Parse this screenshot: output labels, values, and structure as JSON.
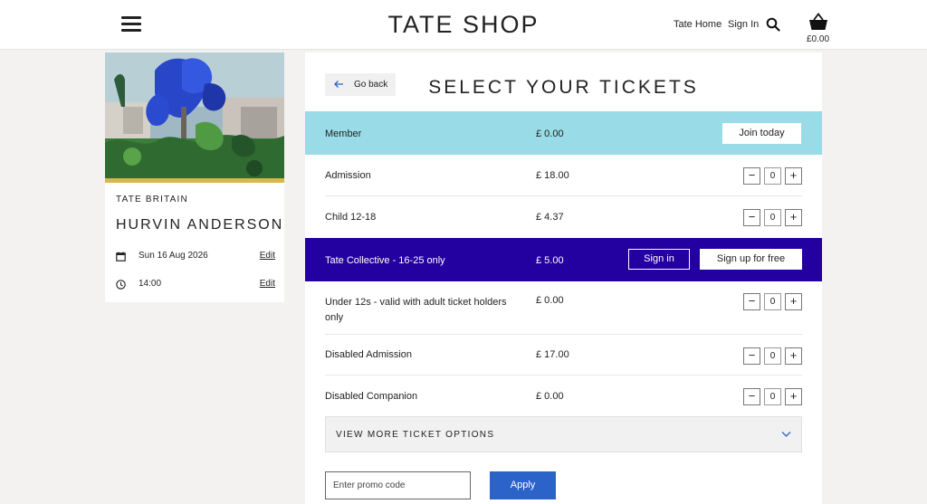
{
  "header": {
    "brand": "TATE SHOP",
    "links": {
      "home": "Tate Home",
      "sign_in": "Sign In"
    },
    "basket_total": "£0.00"
  },
  "event": {
    "venue": "TATE BRITAIN",
    "title": "HURVIN ANDERSON",
    "date": "Sun 16 Aug 2026",
    "time": "14:00",
    "edit_label": "Edit"
  },
  "main": {
    "go_back": "Go back",
    "title": "SELECT YOUR TICKETS",
    "member": {
      "name": "Member",
      "price": "£ 0.00",
      "action": "Join today"
    },
    "tickets": [
      {
        "name": "Admission",
        "price": "£ 18.00",
        "qty": "0"
      },
      {
        "name": "Child 12-18",
        "price": "£ 4.37",
        "qty": "0"
      },
      {
        "name": "Under 12s - valid with adult ticket holders only",
        "price": "£ 0.00",
        "qty": "0"
      },
      {
        "name": "Disabled Admission",
        "price": "£ 17.00",
        "qty": "0"
      },
      {
        "name": "Disabled Companion",
        "price": "£ 0.00",
        "qty": "0"
      }
    ],
    "collective": {
      "name": "Tate Collective - 16-25 only",
      "price": "£ 5.00",
      "sign_in": "Sign in",
      "sign_up": "Sign up for free"
    },
    "more_options": "VIEW MORE TICKET OPTIONS",
    "promo_placeholder": "Enter promo code",
    "apply": "Apply",
    "stepper_minus": "−",
    "stepper_plus": "+"
  },
  "colors": {
    "member_band": "#99dbe6",
    "collective_band": "#2300a0",
    "apply_button": "#2b63c8"
  }
}
